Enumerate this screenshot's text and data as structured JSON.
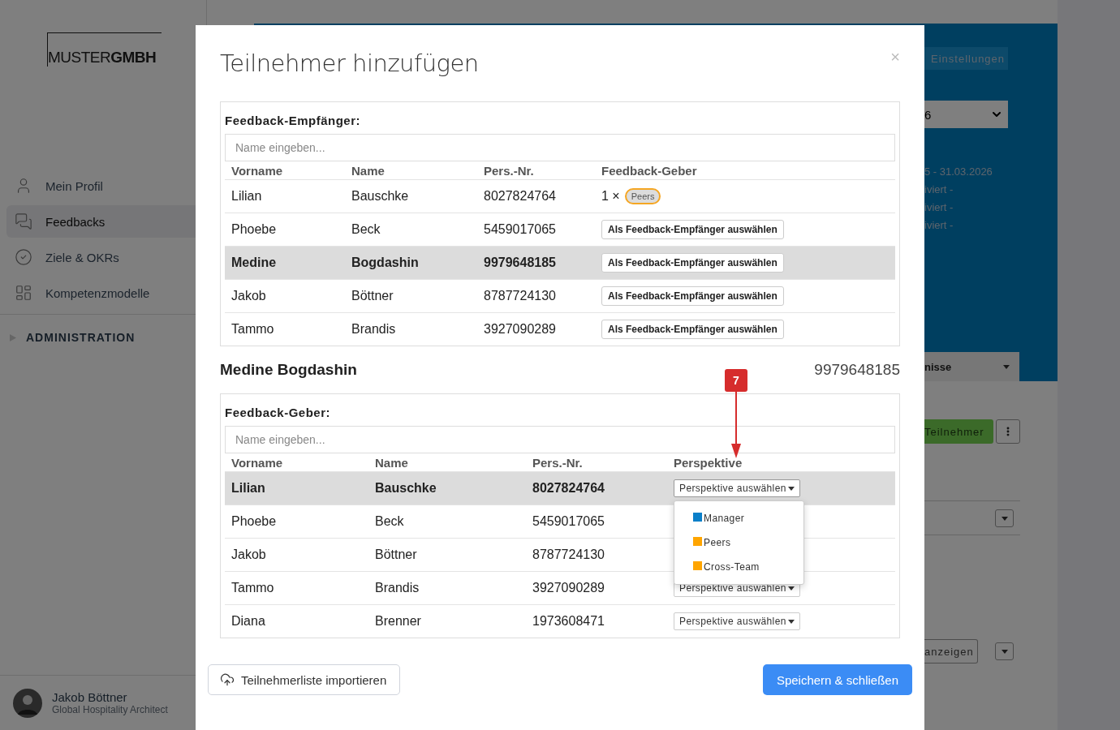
{
  "sidebar": {
    "logo": {
      "light": "MUSTER",
      "bold": "GMBH"
    },
    "items": [
      {
        "label": "Mein Profil",
        "selected": false
      },
      {
        "label": "Feedbacks",
        "selected": true
      },
      {
        "label": "Ziele & OKRs",
        "selected": false
      },
      {
        "label": "Kompetenzmodelle",
        "selected": false
      }
    ],
    "section": {
      "label": "ADMINISTRATION",
      "expanded": false
    },
    "user": {
      "name": "Jakob Böttner",
      "role": "Global Hospitality Architect"
    }
  },
  "background": {
    "settings_button": "Einstellungen",
    "period_select": "6",
    "info_lines": [
      "5 - 31.03.2026",
      "iviert -",
      "iviert -",
      "iviert -"
    ],
    "tab": "nisse",
    "participants_button": "Teilnehmer",
    "show_button": "anzeigen"
  },
  "modal": {
    "title": "Teilnehmer hinzufügen",
    "close": "×",
    "recipients": {
      "label": "Feedback-Empfänger:",
      "placeholder": "Name eingeben...",
      "columns": [
        "Vorname",
        "Name",
        "Pers.-Nr.",
        "Feedback-Geber"
      ],
      "rows": [
        {
          "first": "Lilian",
          "last": "Bauschke",
          "number": "8027824764",
          "selected": false,
          "giver_count": "1 ×",
          "giver_tag": {
            "label": "Peers",
            "color": "#f5a623"
          }
        },
        {
          "first": "Phoebe",
          "last": "Beck",
          "number": "5459017065",
          "selected": false,
          "action": "Als Feedback-Empfänger auswählen"
        },
        {
          "first": "Medine",
          "last": "Bogdashin",
          "number": "9979648185",
          "selected": true,
          "action": "Als Feedback-Empfänger auswählen"
        },
        {
          "first": "Jakob",
          "last": "Böttner",
          "number": "8787724130",
          "selected": false,
          "action": "Als Feedback-Empfänger auswählen"
        },
        {
          "first": "Tammo",
          "last": "Brandis",
          "number": "3927090289",
          "selected": false,
          "action": "Als Feedback-Empfänger auswählen"
        }
      ]
    },
    "selected_recipient": {
      "name": "Medine Bogdashin",
      "number": "9979648185"
    },
    "givers": {
      "label": "Feedback-Geber:",
      "placeholder": "Name eingeben...",
      "columns": [
        "Vorname",
        "Name",
        "Pers.-Nr.",
        "Perspektive"
      ],
      "rows": [
        {
          "first": "Lilian",
          "last": "Bauschke",
          "number": "8027824764",
          "selected": true,
          "perspective": "Perspektive auswählen",
          "expanded": true
        },
        {
          "first": "Phoebe",
          "last": "Beck",
          "number": "5459017065",
          "selected": false
        },
        {
          "first": "Jakob",
          "last": "Böttner",
          "number": "8787724130",
          "selected": false
        },
        {
          "first": "Tammo",
          "last": "Brandis",
          "number": "3927090289",
          "selected": false,
          "perspective": "Perspektive auswählen",
          "expanded": false
        },
        {
          "first": "Diana",
          "last": "Brenner",
          "number": "1973608471",
          "selected": false,
          "perspective": "Perspektive auswählen",
          "expanded": false
        }
      ],
      "perspective_menu": [
        {
          "label": "Manager",
          "color": "#0a7fc9"
        },
        {
          "label": "Peers",
          "color": "#ffa500"
        },
        {
          "label": "Cross-Team",
          "color": "#ffa500"
        }
      ]
    },
    "import_button": "Teilnehmerliste importieren",
    "save_button": "Speichern & schließen"
  },
  "annotation": {
    "label": "7"
  }
}
